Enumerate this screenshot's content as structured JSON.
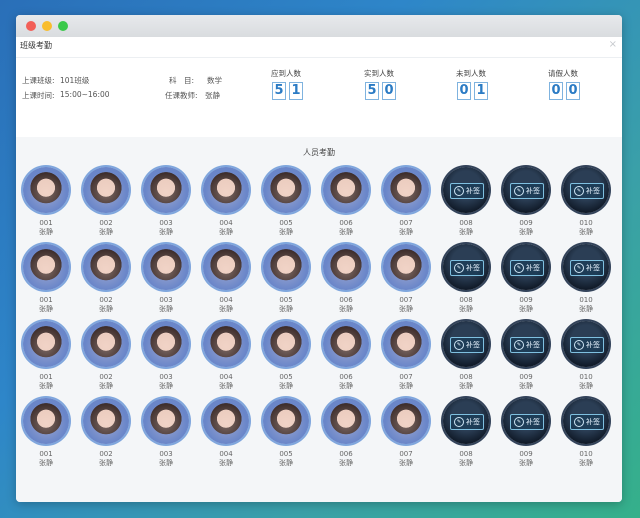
{
  "dialog": {
    "title": "班级考勤",
    "close_icon": "×"
  },
  "class_info": {
    "class_label": "上课班级:",
    "class_value": "101班级",
    "time_label": "上课时间:",
    "time_value": "15:00~16:00",
    "subject_label": "科　目:",
    "subject_value": "数学",
    "teacher_label": "任课教师:",
    "teacher_value": "张静"
  },
  "stats": [
    {
      "label": "应到人数",
      "digits": [
        "5",
        "1"
      ]
    },
    {
      "label": "实到人数",
      "digits": [
        "5",
        "0"
      ]
    },
    {
      "label": "未到人数",
      "digits": [
        "0",
        "1"
      ]
    },
    {
      "label": "请假人数",
      "digits": [
        "0",
        "0"
      ]
    }
  ],
  "attendance": {
    "title": "人员考勤",
    "resign_label": "补签",
    "rows": [
      [
        {
          "id": "001",
          "name": "张静",
          "present": true
        },
        {
          "id": "002",
          "name": "张静",
          "present": true
        },
        {
          "id": "003",
          "name": "张静",
          "present": true
        },
        {
          "id": "004",
          "name": "张静",
          "present": true
        },
        {
          "id": "005",
          "name": "张静",
          "present": true
        },
        {
          "id": "006",
          "name": "张静",
          "present": true
        },
        {
          "id": "007",
          "name": "张静",
          "present": true
        },
        {
          "id": "008",
          "name": "张静",
          "present": false
        },
        {
          "id": "009",
          "name": "张静",
          "present": false
        },
        {
          "id": "010",
          "name": "张静",
          "present": false
        }
      ],
      [
        {
          "id": "001",
          "name": "张静",
          "present": true
        },
        {
          "id": "002",
          "name": "张静",
          "present": true
        },
        {
          "id": "003",
          "name": "张静",
          "present": true
        },
        {
          "id": "004",
          "name": "张静",
          "present": true
        },
        {
          "id": "005",
          "name": "张静",
          "present": true
        },
        {
          "id": "006",
          "name": "张静",
          "present": true
        },
        {
          "id": "007",
          "name": "张静",
          "present": true
        },
        {
          "id": "008",
          "name": "张静",
          "present": false
        },
        {
          "id": "009",
          "name": "张静",
          "present": false
        },
        {
          "id": "010",
          "name": "张静",
          "present": false
        }
      ],
      [
        {
          "id": "001",
          "name": "张静",
          "present": true
        },
        {
          "id": "002",
          "name": "张静",
          "present": true
        },
        {
          "id": "003",
          "name": "张静",
          "present": true
        },
        {
          "id": "004",
          "name": "张静",
          "present": true
        },
        {
          "id": "005",
          "name": "张静",
          "present": true
        },
        {
          "id": "006",
          "name": "张静",
          "present": true
        },
        {
          "id": "007",
          "name": "张静",
          "present": true
        },
        {
          "id": "008",
          "name": "张静",
          "present": false
        },
        {
          "id": "009",
          "name": "张静",
          "present": false
        },
        {
          "id": "010",
          "name": "张静",
          "present": false
        }
      ],
      [
        {
          "id": "001",
          "name": "张静",
          "present": true
        },
        {
          "id": "002",
          "name": "张静",
          "present": true
        },
        {
          "id": "003",
          "name": "张静",
          "present": true
        },
        {
          "id": "004",
          "name": "张静",
          "present": true
        },
        {
          "id": "005",
          "name": "张静",
          "present": true
        },
        {
          "id": "006",
          "name": "张静",
          "present": true
        },
        {
          "id": "007",
          "name": "张静",
          "present": true
        },
        {
          "id": "008",
          "name": "张静",
          "present": false
        },
        {
          "id": "009",
          "name": "张静",
          "present": false
        },
        {
          "id": "010",
          "name": "张静",
          "present": false
        }
      ]
    ]
  }
}
